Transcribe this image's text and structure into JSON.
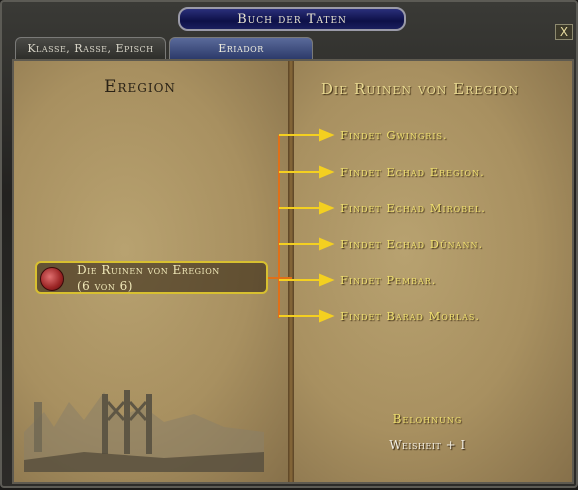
{
  "window": {
    "title": "Buch der Taten",
    "close_label": "X"
  },
  "tabs": [
    {
      "label": "Klasse, Rasse, Episch",
      "active": false
    },
    {
      "label": "Eriador",
      "active": true
    }
  ],
  "left_page": {
    "region_title": "Eregion",
    "deed": {
      "name": "Die Ruinen von Eregion",
      "progress": "(6 von 6)",
      "icon": "wax-seal-icon"
    }
  },
  "right_page": {
    "deed_title": "Die Ruinen von Eregion",
    "objectives": [
      "Findet Gwingris.",
      "Findet Echad Eregion.",
      "Findet Echad Mirobel.",
      "Findet Echad Dûnann.",
      "Findet Pembar.",
      "Findet Barad Morlas."
    ],
    "reward_heading": "Belohnung",
    "reward_value": "Weisheit + I"
  },
  "colors": {
    "accent_gold": "#f0e070",
    "deed_border": "#d8c030",
    "connector_orange": "#e07018",
    "arrow_yellow": "#f4d020"
  }
}
